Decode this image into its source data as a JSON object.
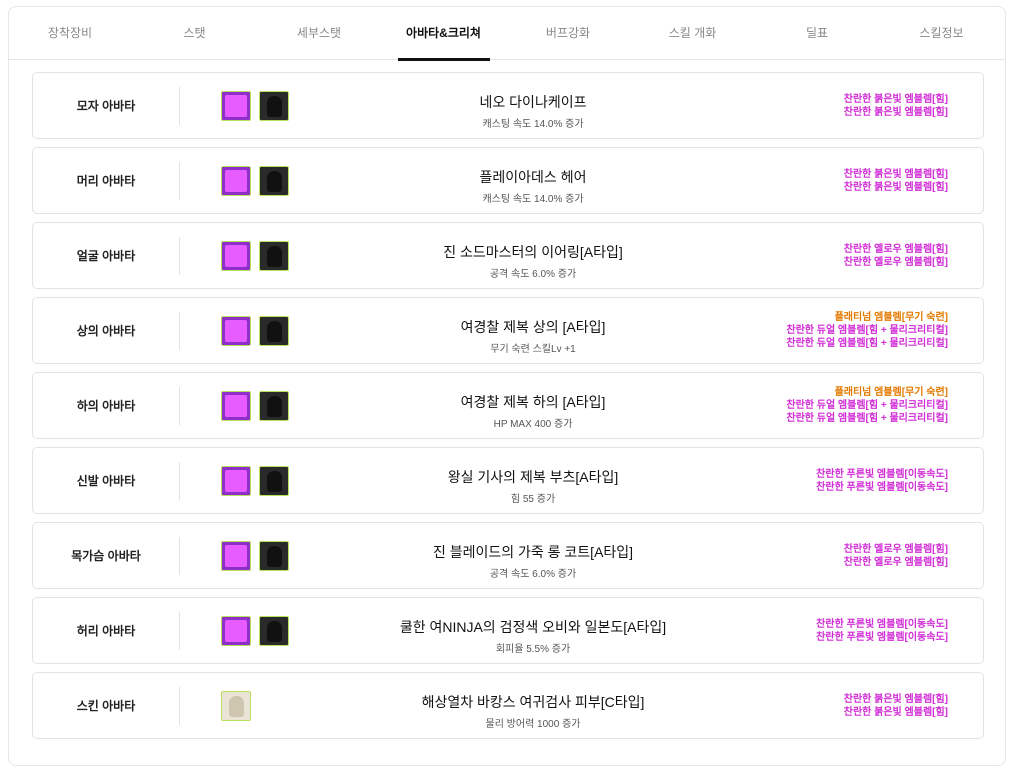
{
  "colors": {
    "accent": "#111111",
    "emblem_magenta": "#d12dd6",
    "emblem_orange": "#e27a00",
    "clone_icon_bg": "#8e2fc9"
  },
  "tabs": [
    {
      "label": "장착장비",
      "active": false
    },
    {
      "label": "스탯",
      "active": false
    },
    {
      "label": "세부스탯",
      "active": false
    },
    {
      "label": "아바타&크리쳐",
      "active": true
    },
    {
      "label": "버프강화",
      "active": false
    },
    {
      "label": "스킬 개화",
      "active": false
    },
    {
      "label": "딜표",
      "active": false
    },
    {
      "label": "스킬정보",
      "active": false
    }
  ],
  "avatars": [
    {
      "slot": "모자 아바타",
      "clone_icon": true,
      "name": "네오 다이나케이프",
      "effect": "캐스팅 속도 14.0% 증가",
      "emblems": [
        {
          "text": "찬란한 붉은빛 엠블렘[힘]",
          "color": "#d12dd6"
        },
        {
          "text": "찬란한 붉은빛 엠블렘[힘]",
          "color": "#d12dd6"
        }
      ]
    },
    {
      "slot": "머리 아바타",
      "clone_icon": true,
      "name": "플레이아데스 헤어",
      "effect": "캐스팅 속도 14.0% 증가",
      "emblems": [
        {
          "text": "찬란한 붉은빛 엠블렘[힘]",
          "color": "#d12dd6"
        },
        {
          "text": "찬란한 붉은빛 엠블렘[힘]",
          "color": "#d12dd6"
        }
      ]
    },
    {
      "slot": "얼굴 아바타",
      "clone_icon": true,
      "name": "진 소드마스터의 이어링[A타입]",
      "effect": "공격 속도 6.0% 증가",
      "emblems": [
        {
          "text": "찬란한 옐로우 엠블렘[힘]",
          "color": "#d12dd6"
        },
        {
          "text": "찬란한 옐로우 엠블렘[힘]",
          "color": "#d12dd6"
        }
      ]
    },
    {
      "slot": "상의 아바타",
      "clone_icon": true,
      "name": "여경찰 제복 상의 [A타입]",
      "effect": "무기 숙련 스킬Lv +1",
      "emblems": [
        {
          "text": "플래티넘 엠블렘[무기 숙련]",
          "color": "#e27a00"
        },
        {
          "text": "찬란한 듀얼 엠블렘[힘 + 물리크리티컬]",
          "color": "#d12dd6"
        },
        {
          "text": "찬란한 듀얼 엠블렘[힘 + 물리크리티컬]",
          "color": "#d12dd6"
        }
      ]
    },
    {
      "slot": "하의 아바타",
      "clone_icon": true,
      "name": "여경찰 제복 하의 [A타입]",
      "effect": "HP MAX 400 증가",
      "emblems": [
        {
          "text": "플래티넘 엠블렘[무기 숙련]",
          "color": "#e27a00"
        },
        {
          "text": "찬란한 듀얼 엠블렘[힘 + 물리크리티컬]",
          "color": "#d12dd6"
        },
        {
          "text": "찬란한 듀얼 엠블렘[힘 + 물리크리티컬]",
          "color": "#d12dd6"
        }
      ]
    },
    {
      "slot": "신발 아바타",
      "clone_icon": true,
      "name": "왕실 기사의 제복 부츠[A타입]",
      "effect": "힘 55 증가",
      "emblems": [
        {
          "text": "찬란한 푸른빛 엠블렘[이동속도]",
          "color": "#d12dd6"
        },
        {
          "text": "찬란한 푸른빛 엠블렘[이동속도]",
          "color": "#d12dd6"
        }
      ]
    },
    {
      "slot": "목가슴 아바타",
      "clone_icon": true,
      "name": "진 블레이드의 가죽 롱 코트[A타입]",
      "effect": "공격 속도 6.0% 증가",
      "emblems": [
        {
          "text": "찬란한 옐로우 엠블렘[힘]",
          "color": "#d12dd6"
        },
        {
          "text": "찬란한 옐로우 엠블렘[힘]",
          "color": "#d12dd6"
        }
      ]
    },
    {
      "slot": "허리 아바타",
      "clone_icon": true,
      "name": "쿨한 여NINJA의 검정색 오비와 일본도[A타입]",
      "effect": "회피율 5.5% 증가",
      "emblems": [
        {
          "text": "찬란한 푸른빛 엠블렘[이동속도]",
          "color": "#d12dd6"
        },
        {
          "text": "찬란한 푸른빛 엠블렘[이동속도]",
          "color": "#d12dd6"
        }
      ]
    },
    {
      "slot": "스킨 아바타",
      "clone_icon": false,
      "name": "해상열차 바캉스 여귀검사 피부[C타입]",
      "effect": "물리 방어력 1000 증가",
      "emblems": [
        {
          "text": "찬란한 붉은빛 엠블렘[힘]",
          "color": "#d12dd6"
        },
        {
          "text": "찬란한 붉은빛 엠블렘[힘]",
          "color": "#d12dd6"
        }
      ]
    }
  ]
}
